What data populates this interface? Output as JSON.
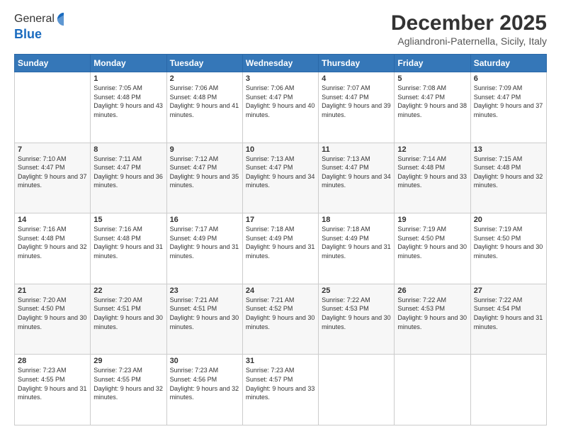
{
  "header": {
    "logo_line1": "General",
    "logo_line2": "Blue",
    "month_title": "December 2025",
    "location": "Agliandroni-Paternella, Sicily, Italy"
  },
  "days_of_week": [
    "Sunday",
    "Monday",
    "Tuesday",
    "Wednesday",
    "Thursday",
    "Friday",
    "Saturday"
  ],
  "weeks": [
    [
      {
        "day": "",
        "sunrise": "",
        "sunset": "",
        "daylight": ""
      },
      {
        "day": "1",
        "sunrise": "Sunrise: 7:05 AM",
        "sunset": "Sunset: 4:48 PM",
        "daylight": "Daylight: 9 hours and 43 minutes."
      },
      {
        "day": "2",
        "sunrise": "Sunrise: 7:06 AM",
        "sunset": "Sunset: 4:48 PM",
        "daylight": "Daylight: 9 hours and 41 minutes."
      },
      {
        "day": "3",
        "sunrise": "Sunrise: 7:06 AM",
        "sunset": "Sunset: 4:47 PM",
        "daylight": "Daylight: 9 hours and 40 minutes."
      },
      {
        "day": "4",
        "sunrise": "Sunrise: 7:07 AM",
        "sunset": "Sunset: 4:47 PM",
        "daylight": "Daylight: 9 hours and 39 minutes."
      },
      {
        "day": "5",
        "sunrise": "Sunrise: 7:08 AM",
        "sunset": "Sunset: 4:47 PM",
        "daylight": "Daylight: 9 hours and 38 minutes."
      },
      {
        "day": "6",
        "sunrise": "Sunrise: 7:09 AM",
        "sunset": "Sunset: 4:47 PM",
        "daylight": "Daylight: 9 hours and 37 minutes."
      }
    ],
    [
      {
        "day": "7",
        "sunrise": "Sunrise: 7:10 AM",
        "sunset": "Sunset: 4:47 PM",
        "daylight": "Daylight: 9 hours and 37 minutes."
      },
      {
        "day": "8",
        "sunrise": "Sunrise: 7:11 AM",
        "sunset": "Sunset: 4:47 PM",
        "daylight": "Daylight: 9 hours and 36 minutes."
      },
      {
        "day": "9",
        "sunrise": "Sunrise: 7:12 AM",
        "sunset": "Sunset: 4:47 PM",
        "daylight": "Daylight: 9 hours and 35 minutes."
      },
      {
        "day": "10",
        "sunrise": "Sunrise: 7:13 AM",
        "sunset": "Sunset: 4:47 PM",
        "daylight": "Daylight: 9 hours and 34 minutes."
      },
      {
        "day": "11",
        "sunrise": "Sunrise: 7:13 AM",
        "sunset": "Sunset: 4:47 PM",
        "daylight": "Daylight: 9 hours and 34 minutes."
      },
      {
        "day": "12",
        "sunrise": "Sunrise: 7:14 AM",
        "sunset": "Sunset: 4:48 PM",
        "daylight": "Daylight: 9 hours and 33 minutes."
      },
      {
        "day": "13",
        "sunrise": "Sunrise: 7:15 AM",
        "sunset": "Sunset: 4:48 PM",
        "daylight": "Daylight: 9 hours and 32 minutes."
      }
    ],
    [
      {
        "day": "14",
        "sunrise": "Sunrise: 7:16 AM",
        "sunset": "Sunset: 4:48 PM",
        "daylight": "Daylight: 9 hours and 32 minutes."
      },
      {
        "day": "15",
        "sunrise": "Sunrise: 7:16 AM",
        "sunset": "Sunset: 4:48 PM",
        "daylight": "Daylight: 9 hours and 31 minutes."
      },
      {
        "day": "16",
        "sunrise": "Sunrise: 7:17 AM",
        "sunset": "Sunset: 4:49 PM",
        "daylight": "Daylight: 9 hours and 31 minutes."
      },
      {
        "day": "17",
        "sunrise": "Sunrise: 7:18 AM",
        "sunset": "Sunset: 4:49 PM",
        "daylight": "Daylight: 9 hours and 31 minutes."
      },
      {
        "day": "18",
        "sunrise": "Sunrise: 7:18 AM",
        "sunset": "Sunset: 4:49 PM",
        "daylight": "Daylight: 9 hours and 31 minutes."
      },
      {
        "day": "19",
        "sunrise": "Sunrise: 7:19 AM",
        "sunset": "Sunset: 4:50 PM",
        "daylight": "Daylight: 9 hours and 30 minutes."
      },
      {
        "day": "20",
        "sunrise": "Sunrise: 7:19 AM",
        "sunset": "Sunset: 4:50 PM",
        "daylight": "Daylight: 9 hours and 30 minutes."
      }
    ],
    [
      {
        "day": "21",
        "sunrise": "Sunrise: 7:20 AM",
        "sunset": "Sunset: 4:50 PM",
        "daylight": "Daylight: 9 hours and 30 minutes."
      },
      {
        "day": "22",
        "sunrise": "Sunrise: 7:20 AM",
        "sunset": "Sunset: 4:51 PM",
        "daylight": "Daylight: 9 hours and 30 minutes."
      },
      {
        "day": "23",
        "sunrise": "Sunrise: 7:21 AM",
        "sunset": "Sunset: 4:51 PM",
        "daylight": "Daylight: 9 hours and 30 minutes."
      },
      {
        "day": "24",
        "sunrise": "Sunrise: 7:21 AM",
        "sunset": "Sunset: 4:52 PM",
        "daylight": "Daylight: 9 hours and 30 minutes."
      },
      {
        "day": "25",
        "sunrise": "Sunrise: 7:22 AM",
        "sunset": "Sunset: 4:53 PM",
        "daylight": "Daylight: 9 hours and 30 minutes."
      },
      {
        "day": "26",
        "sunrise": "Sunrise: 7:22 AM",
        "sunset": "Sunset: 4:53 PM",
        "daylight": "Daylight: 9 hours and 30 minutes."
      },
      {
        "day": "27",
        "sunrise": "Sunrise: 7:22 AM",
        "sunset": "Sunset: 4:54 PM",
        "daylight": "Daylight: 9 hours and 31 minutes."
      }
    ],
    [
      {
        "day": "28",
        "sunrise": "Sunrise: 7:23 AM",
        "sunset": "Sunset: 4:55 PM",
        "daylight": "Daylight: 9 hours and 31 minutes."
      },
      {
        "day": "29",
        "sunrise": "Sunrise: 7:23 AM",
        "sunset": "Sunset: 4:55 PM",
        "daylight": "Daylight: 9 hours and 32 minutes."
      },
      {
        "day": "30",
        "sunrise": "Sunrise: 7:23 AM",
        "sunset": "Sunset: 4:56 PM",
        "daylight": "Daylight: 9 hours and 32 minutes."
      },
      {
        "day": "31",
        "sunrise": "Sunrise: 7:23 AM",
        "sunset": "Sunset: 4:57 PM",
        "daylight": "Daylight: 9 hours and 33 minutes."
      },
      {
        "day": "",
        "sunrise": "",
        "sunset": "",
        "daylight": ""
      },
      {
        "day": "",
        "sunrise": "",
        "sunset": "",
        "daylight": ""
      },
      {
        "day": "",
        "sunrise": "",
        "sunset": "",
        "daylight": ""
      }
    ]
  ]
}
